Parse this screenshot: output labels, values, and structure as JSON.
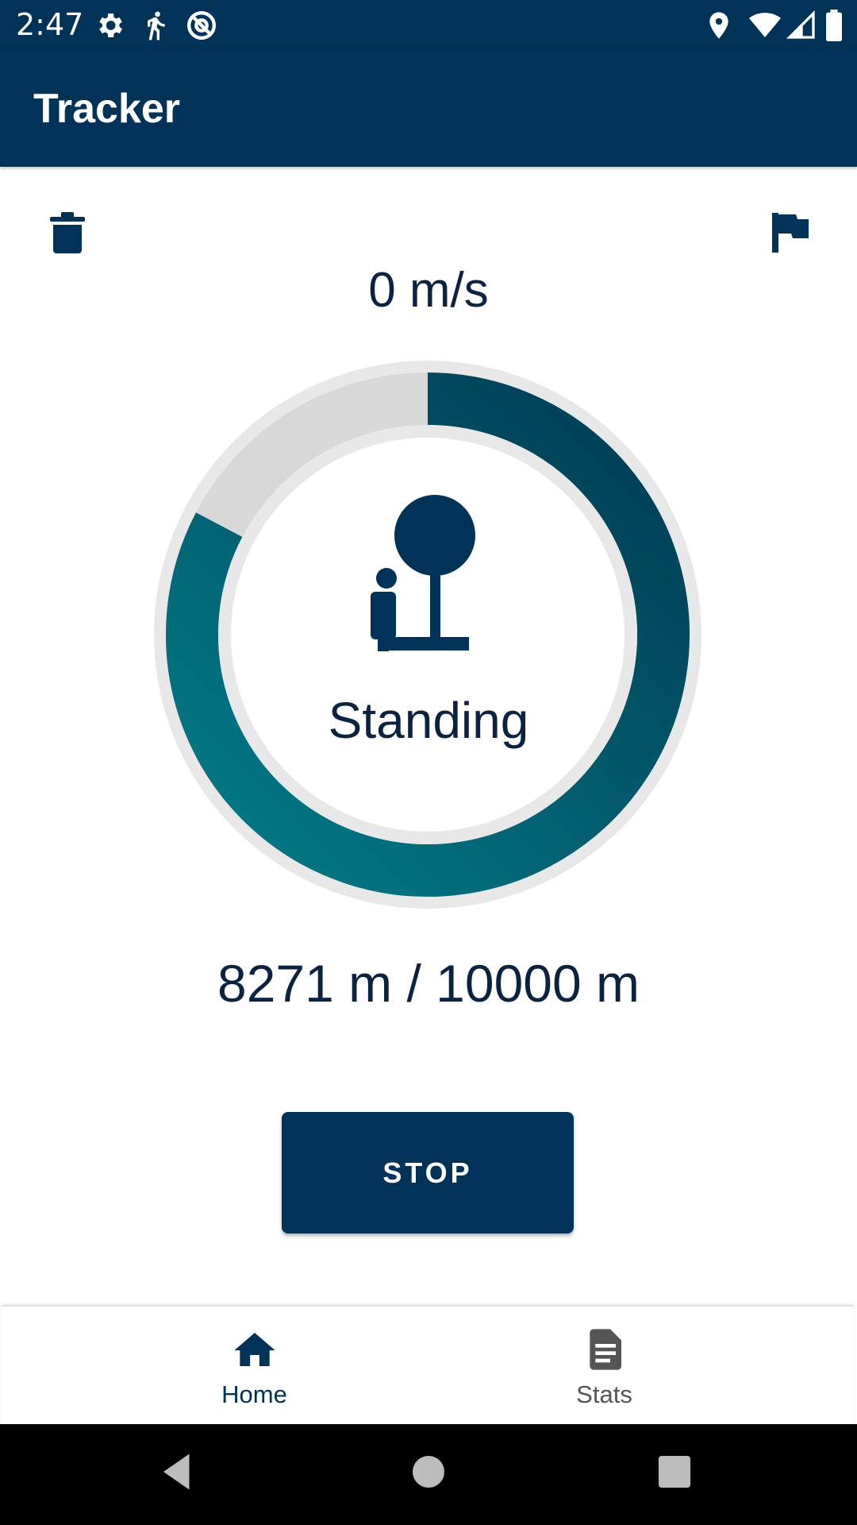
{
  "status_bar": {
    "time": "2:47",
    "left_icons": [
      "gear-icon",
      "running-person-icon",
      "at-sign-icon"
    ],
    "right_icons": [
      "location-pin-icon",
      "wifi-icon",
      "cell-signal-icon",
      "battery-icon"
    ]
  },
  "app_bar": {
    "title": "Tracker"
  },
  "toolbar": {
    "delete_icon": "trash-icon",
    "finish_icon": "flag-icon"
  },
  "tracker": {
    "speed": "0 m/s",
    "activity": "Standing",
    "activity_icon": "person-with-tree-icon",
    "distance": "8271 m / 10000 m",
    "progress": 0.8271,
    "progress_gradient": [
      "#037d89",
      "#003a52"
    ],
    "track_color": "#d8d8d8"
  },
  "actions": {
    "stop_label": "STOP"
  },
  "bottom_nav": {
    "items": [
      {
        "label": "Home",
        "icon": "home-icon",
        "selected": true
      },
      {
        "label": "Stats",
        "icon": "document-icon",
        "selected": false
      }
    ]
  },
  "colors": {
    "primary": "#003357",
    "text_dark": "#0b2340"
  }
}
